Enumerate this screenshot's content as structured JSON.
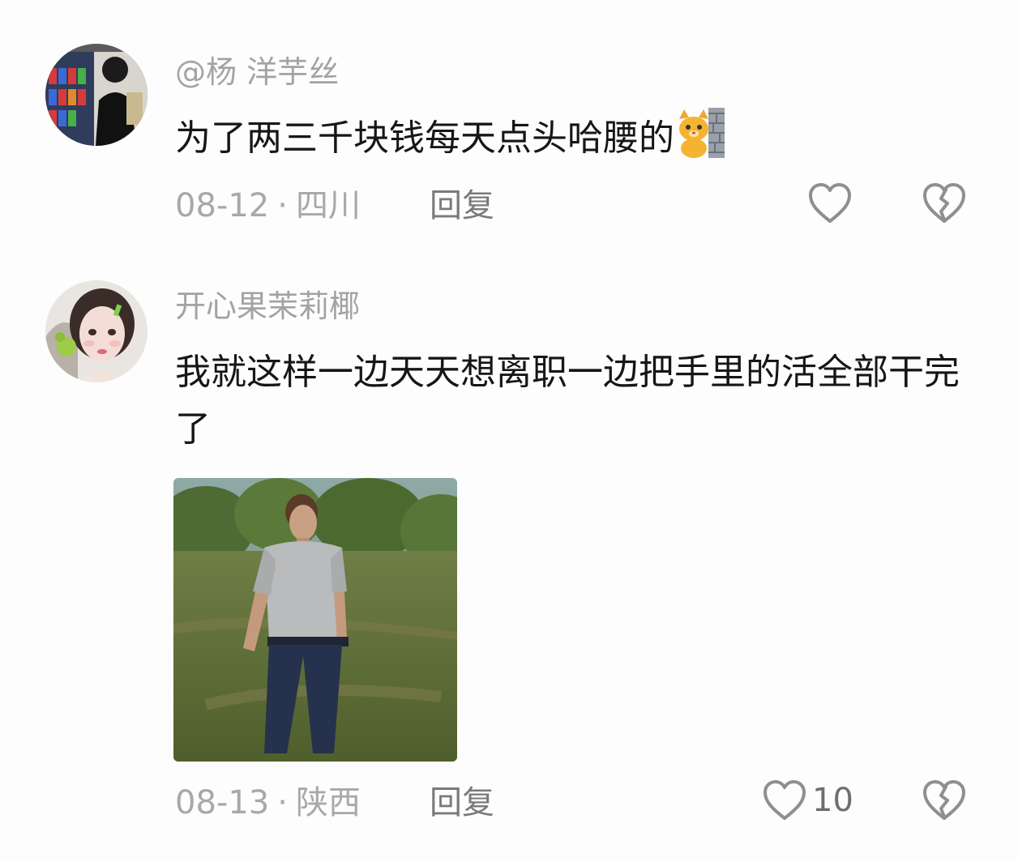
{
  "comments": [
    {
      "username": "@杨 洋芋丝",
      "content": "为了两三千块钱每天点头哈腰的",
      "emoji": "cat-wall-emoji",
      "date": "08-12",
      "location": "四川",
      "reply_label": "回复",
      "like_count": ""
    },
    {
      "username": "开心果茉莉椰",
      "content": "我就这样一边天天想离职一边把手里的活全部干完了",
      "date": "08-13",
      "location": "陕西",
      "reply_label": "回复",
      "like_count": "10",
      "image": "man-walking-in-field-image"
    }
  ],
  "icons": {
    "like": "heart-outline-icon",
    "dislike": "broken-heart-icon"
  },
  "colors": {
    "background": "#fdfdfd",
    "username": "#a3a3a3",
    "text": "#161616",
    "meta": "#a8a8a8",
    "icon": "#8f8f8f"
  },
  "separator": "·"
}
